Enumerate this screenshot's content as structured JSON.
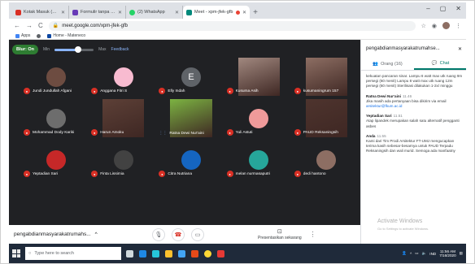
{
  "browser": {
    "tabs": [
      {
        "title": "Kotak Masuk (140) - anisa@fkun",
        "icon_color": "#d93025"
      },
      {
        "title": "Formulir tanpa judul - Google F",
        "icon_color": "#673ab7"
      },
      {
        "title": "(2) WhatsApp",
        "icon_color": "#25d366"
      },
      {
        "title": "Meet - xpm-jfek-gfb",
        "icon_color": "#00897b",
        "active": true
      }
    ],
    "new_tab": "+",
    "window_buttons": [
      "–",
      "▢",
      "✕"
    ],
    "back": "←",
    "forward": "→",
    "reload": "C",
    "url": "meet.google.com/xpm-jfek-gfb",
    "bookmarks": [
      {
        "label": "Apps",
        "icon_color": "#4285f4"
      },
      {
        "label": "",
        "icon_color": "#5f6368"
      },
      {
        "label": "Home - Mateneco",
        "icon_color": "#0d47a1"
      }
    ]
  },
  "meet": {
    "blur_label": "Blur: On",
    "min_label": "Min",
    "max_label": "Max",
    "blur_level": 0.6,
    "feedback_label": "Feedback",
    "participants": [
      {
        "name": "Jundi Jundullah Afgani",
        "kind": "avatar",
        "color": "#6d4c41",
        "muted": true
      },
      {
        "name": "Anggana Fitri S",
        "kind": "avatar",
        "color": "#f8bbd0",
        "muted": true
      },
      {
        "name": "Elly Indah",
        "kind": "letter",
        "letter": "E",
        "color": "#5f6368",
        "muted": true
      },
      {
        "name": "Kusuma Asih",
        "kind": "photo",
        "color": "#a1887f",
        "muted": true
      },
      {
        "name": "kusumaningrum 157",
        "kind": "photo",
        "color": "#8d6e63",
        "muted": true
      },
      {
        "name": "Mohammad Dody Kariki",
        "kind": "avatar",
        "color": "#6d6d6d",
        "muted": true
      },
      {
        "name": "Harun Amoku",
        "kind": "photo",
        "color": "#5d4037",
        "muted": true
      },
      {
        "name": "Ratna Dewi Nur'aini",
        "kind": "photo",
        "color": "#7cb342",
        "muted": false,
        "speaking": true
      },
      {
        "name": "Yuli Astuti",
        "kind": "avatar",
        "color": "#ef9a9a",
        "muted": true
      },
      {
        "name": "PAUD Reksaningsih",
        "kind": "photo",
        "color": "#4e342e",
        "muted": true
      },
      {
        "name": "Yeptadian Sari",
        "kind": "avatar",
        "color": "#c62828",
        "muted": true
      },
      {
        "name": "Finta Lissimia",
        "kind": "avatar",
        "color": "#424242",
        "muted": true
      },
      {
        "name": "Citra Nutriana",
        "kind": "avatar",
        "color": "#1565c0",
        "muted": true
      },
      {
        "name": "melan nurmasaputri",
        "kind": "avatar",
        "color": "#26a69a",
        "muted": true
      },
      {
        "name": "dedi hantono",
        "kind": "avatar",
        "color": "#8d6e63",
        "muted": true
      }
    ],
    "meeting_name": "pengabdianmasyarakatrumahs...",
    "chevron": "^",
    "present_label": "Presentasikan sekarang"
  },
  "panel": {
    "title": "pengabdianmasyarakatrumahse...",
    "close": "✕",
    "tab_people": "Orang (16)",
    "tab_chat": "Chat",
    "messages": [
      {
        "who": "",
        "time": "",
        "text": "kekuatan pancaran sinar. Lampu 6 watt max utk ruang 9m persegi (60 menit) Lampu 8 watt max utk ruang 12m persegi (60 menit) Sterilisasi dilakukan 1-2x/ minggu"
      },
      {
        "who": "Ratna Dewi Nur'aini",
        "time": "11.46",
        "text": "Jika masih ada pertanyaan bisa dikirim via email ",
        "link": "arsitektur@fkum.ac.id"
      },
      {
        "who": "Yeptadian Sari",
        "time": "11.51",
        "text": "Atap lipandek merupakan salah satu alternatif pengganti asbes"
      },
      {
        "who": "Anda",
        "time": "11.55",
        "text": "Kami dari Tim Prodi Arsitektur FT-UMJ mengucapkan terima kasih sebesar-besarnya untuk PAUD Terpadu Reksaningsih dan wali murid. Semoga ada manfaatny"
      }
    ],
    "activate_title": "Activate Windows",
    "activate_sub": "Go to Settings to activate Windows."
  },
  "taskbar": {
    "search_placeholder": "Type here to search",
    "time": "11:56 AM",
    "date": "7/16/2020",
    "lang": "IND"
  }
}
